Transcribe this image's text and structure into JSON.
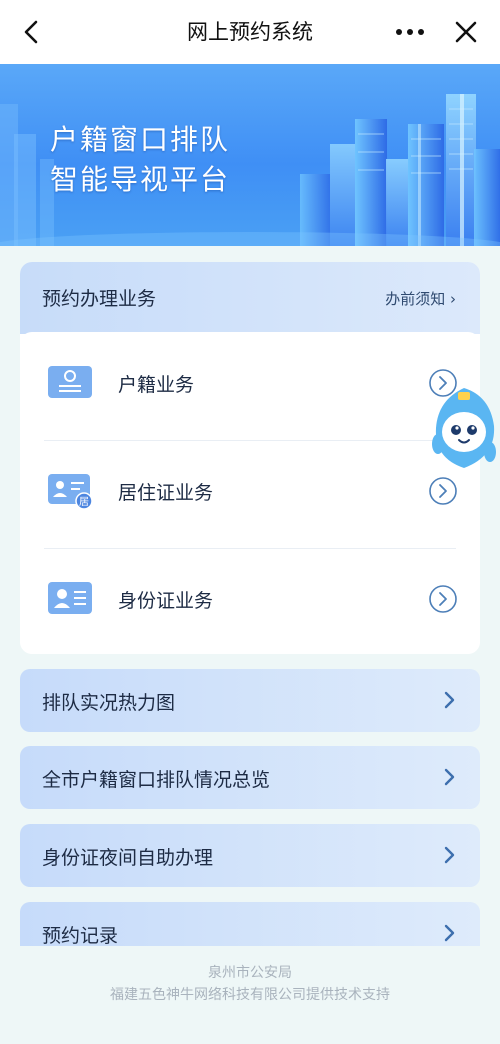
{
  "nav": {
    "title": "网上预约系统",
    "back_icon": "back-arrow-icon",
    "more_icon": "more-dots-icon",
    "close_icon": "close-icon"
  },
  "banner": {
    "line1": "户籍窗口排队",
    "line2": "智能导视平台"
  },
  "booking": {
    "title": "预约办理业务",
    "notice": "办前须知 ›",
    "services": [
      {
        "label": "户籍业务",
        "icon": "household-register-icon"
      },
      {
        "label": "居住证业务",
        "icon": "residence-permit-icon"
      },
      {
        "label": "身份证业务",
        "icon": "id-card-icon"
      }
    ]
  },
  "menu": [
    {
      "label": "排队实况热力图"
    },
    {
      "label": "全市户籍窗口排队情况总览"
    },
    {
      "label": "身份证夜间自助办理"
    },
    {
      "label": "预约记录"
    }
  ],
  "footer": {
    "line1": "泉州市公安局",
    "line2": "福建五色神牛网络科技有限公司提供技术支持"
  },
  "colors": {
    "accent": "#3f8ff5",
    "card_header": "#c7dcf9",
    "background": "#eef7f7"
  }
}
